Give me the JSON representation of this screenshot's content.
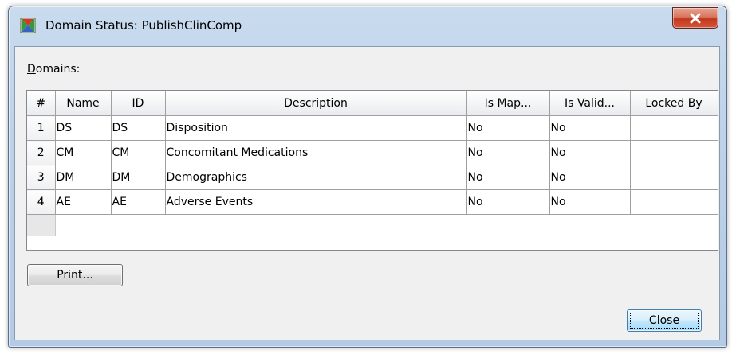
{
  "window": {
    "title": "Domain Status:  PublishClinComp",
    "app_icon": "sas-app-icon",
    "close_icon": "close-x-icon"
  },
  "domains_label": "Domains:",
  "table": {
    "columns": [
      "#",
      "Name",
      "ID",
      "Description",
      "Is Map...",
      "Is Valid...",
      "Locked By"
    ],
    "rows": [
      [
        "1",
        "DS",
        "DS",
        "Disposition",
        "No",
        "No",
        ""
      ],
      [
        "2",
        "CM",
        "CM",
        "Concomitant Medications",
        "No",
        "No",
        ""
      ],
      [
        "3",
        "DM",
        "DM",
        "Demographics",
        "No",
        "No",
        ""
      ],
      [
        "4",
        "AE",
        "AE",
        "Adverse Events",
        "No",
        "No",
        ""
      ]
    ]
  },
  "buttons": {
    "print": "Print...",
    "close": "Close"
  },
  "colors": {
    "close_button_red": "#c0391f",
    "default_button_blue": "#3c7fb1",
    "frame": "#b4cbe6"
  }
}
